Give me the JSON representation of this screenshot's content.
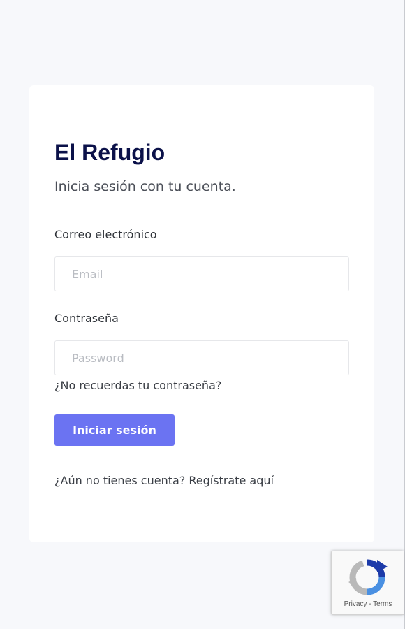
{
  "brand": {
    "title": "El Refugio"
  },
  "login": {
    "subtitle": "Inicia sesión con tu cuenta.",
    "email": {
      "label": "Correo electrónico",
      "placeholder": "Email",
      "value": ""
    },
    "password": {
      "label": "Contraseña",
      "placeholder": "Password",
      "value": ""
    },
    "forgot_link": "¿No recuerdas tu contraseña?",
    "submit_label": "Iniciar sesión",
    "register_link": "¿Aún no tienes cuenta? Regístrate aquí"
  },
  "recaptcha": {
    "icon": "recaptcha-logo-icon",
    "privacy": "Privacy",
    "separator": " - ",
    "terms": "Terms"
  },
  "colors": {
    "page_background": "#f7f8fb",
    "brand_text": "#0b1149",
    "primary_button": "#6b73f2",
    "card_background": "#ffffff"
  }
}
